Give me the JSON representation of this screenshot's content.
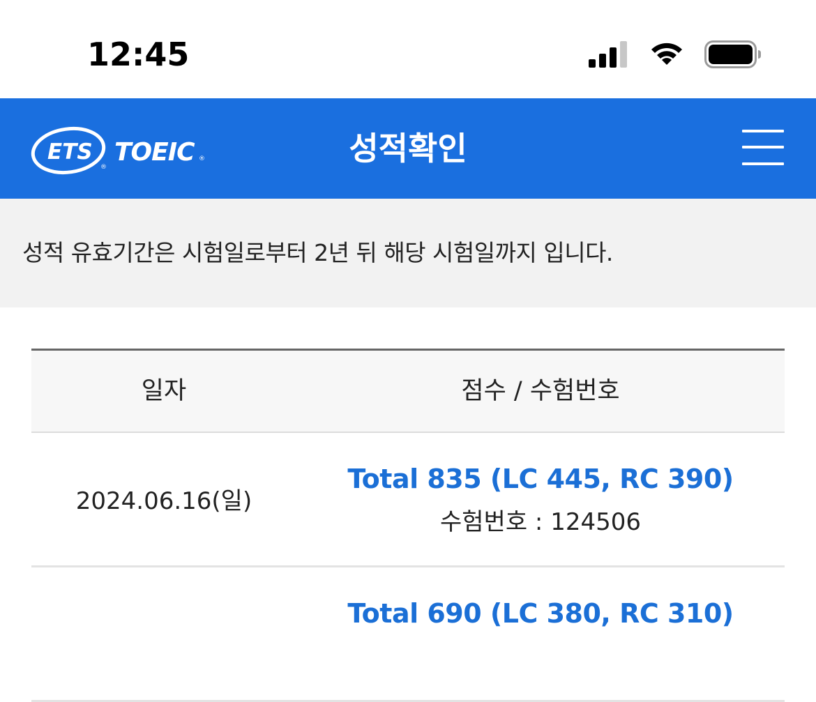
{
  "status_bar": {
    "time": "12:45",
    "icons": [
      "signal-icon",
      "wifi-icon",
      "battery-icon"
    ]
  },
  "header": {
    "logo_text": "ETS TOEIC",
    "title": "성적확인",
    "menu_icon": "hamburger-menu-icon",
    "background_color": "#1a6fdf"
  },
  "notice": {
    "text": "성적 유효기간은 시험일로부터 2년 뒤 해당 시험일까지 입니다."
  },
  "table": {
    "headers": {
      "date": "일자",
      "score": "점수 / 수험번호"
    },
    "rows": [
      {
        "date": "2024.06.16(일)",
        "score": "Total 835 (LC 445, RC 390)",
        "exam_no": "수험번호 : 124506"
      },
      {
        "date": "",
        "score": "Total 690 (LC 380, RC 310)",
        "exam_no": ""
      }
    ]
  },
  "colors": {
    "accent": "#1a6fdf",
    "score_link": "#1b6fd6",
    "notice_bg": "#f2f2f2"
  }
}
